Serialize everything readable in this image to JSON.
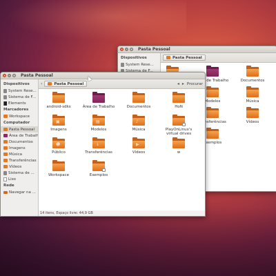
{
  "back_window": {
    "title": "Pasta Pessoal",
    "sidebar": {
      "heading": "Dispositivos",
      "items": [
        {
          "label": "System Rese..."
        },
        {
          "label": "Sistema de F..."
        }
      ]
    },
    "breadcrumb": "Pasta Pessoal",
    "folders": [
      {
        "label": ""
      },
      {
        "label": "Área de Trabalho"
      },
      {
        "label": "Documentos"
      },
      {
        "label": ""
      },
      {
        "label": "Modelos"
      },
      {
        "label": "Música"
      },
      {
        "label": ""
      },
      {
        "label": "Transferências"
      },
      {
        "label": "Vídeos"
      },
      {
        "label": ""
      },
      {
        "label": "Exemplos"
      }
    ]
  },
  "front_window": {
    "title": "Pasta Pessoal",
    "sidebar": {
      "sections": [
        {
          "heading": "Dispositivos",
          "items": [
            {
              "label": "System Rese...",
              "icon": "drive-icon"
            },
            {
              "label": "Sistema de F...",
              "icon": "drive-icon"
            },
            {
              "label": "Elements",
              "icon": "book-icon"
            }
          ]
        },
        {
          "heading": "Marcadores",
          "items": [
            {
              "label": "Workspace",
              "icon": "folder-icon"
            }
          ]
        },
        {
          "heading": "Computador",
          "items": [
            {
              "label": "Pasta Pessoal",
              "icon": "home-folder-icon",
              "selected": true
            },
            {
              "label": "Área de Trabalho",
              "icon": "desktop-folder-icon"
            },
            {
              "label": "Documentos",
              "icon": "folder-icon"
            },
            {
              "label": "Imagens",
              "icon": "folder-icon"
            },
            {
              "label": "Música",
              "icon": "folder-icon"
            },
            {
              "label": "Transferências",
              "icon": "folder-icon"
            },
            {
              "label": "Vídeos",
              "icon": "folder-icon"
            },
            {
              "label": "Sistema de ...",
              "icon": "drive-icon"
            },
            {
              "label": "Lixo",
              "icon": "trash-icon"
            }
          ]
        },
        {
          "heading": "Rede",
          "items": [
            {
              "label": "Navegar na ...",
              "icon": "network-icon"
            }
          ]
        }
      ]
    },
    "breadcrumb": "Pasta Pessoal",
    "search_label": "Procurar",
    "folders": [
      {
        "label": "android-sdks",
        "style": "orange"
      },
      {
        "label": "Área de Trabalho",
        "style": "purple"
      },
      {
        "label": "Documentos",
        "style": "orange"
      },
      {
        "label": "HoN",
        "style": "orange"
      },
      {
        "label": "Imagens",
        "style": "orange",
        "emblem": "▣"
      },
      {
        "label": "Modelos",
        "style": "orange",
        "emblem": "▤"
      },
      {
        "label": "Música",
        "style": "orange",
        "emblem": "♪"
      },
      {
        "label": "PlayOnLinux's virtual drives",
        "style": "orange",
        "corner": true
      },
      {
        "label": "Público",
        "style": "orange",
        "emblem": "☻"
      },
      {
        "label": "Transferências",
        "style": "orange",
        "emblem": "↓"
      },
      {
        "label": "Vídeos",
        "style": "orange",
        "emblem": "▶"
      },
      {
        "label": "w",
        "style": "orange"
      },
      {
        "label": "Workspace",
        "style": "orange"
      },
      {
        "label": "Exemplos",
        "style": "orange",
        "corner": true
      }
    ],
    "status": "14 itens, Espaço livre: 44,9 GB"
  },
  "colors": {
    "accent": "#e6781f",
    "close_button": "#e35a2c",
    "desktop_folder": "#7f2556"
  }
}
